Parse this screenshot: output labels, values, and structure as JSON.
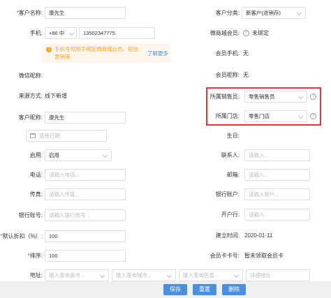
{
  "left": {
    "customer_name_label": "客户名称:",
    "customer_name_value": "康先生",
    "phone_label": "手机:",
    "phone_code": "+86 中",
    "phone_value": "13502347775",
    "warning_text_1": "手机号可用于绑定微商城会员、短信",
    "warning_text_2": "营销等",
    "warning_link": "了解更多",
    "wechat_nick_label": "微信昵称:",
    "source_label": "来源方式:",
    "source_value": "线下新增",
    "nickname_label": "客户昵称:",
    "nickname_value": "康先生",
    "birthday_placeholder": "选择日期",
    "enable_label": "启用:",
    "enable_value": "启用",
    "phone2_label": "电话:",
    "phone2_placeholder": "请输入电话...",
    "fax_label": "传真:",
    "fax_placeholder": "请输入传真...",
    "bank_account_no_label": "银行账号:",
    "bank_account_no_placeholder": "请输入银行账号...",
    "discount_label": "默认折扣（%）:",
    "discount_value": "100",
    "sort_label": "排序:",
    "sort_value": "100",
    "address_label": "地址:",
    "province_placeholder": "输入查询省市...",
    "city_placeholder": "输入查询城市...",
    "district_placeholder": "输入查询区县...",
    "detail_placeholder": "详细地址"
  },
  "right": {
    "category_label": "客户分类:",
    "category_value": "新客户(进销存)",
    "mall_member_label": "微商城会员:",
    "mall_member_value": "未绑定",
    "member_phone_label": "会员手机:",
    "member_phone_value": "无",
    "member_nick_label": "会员昵称:",
    "member_nick_value": "无",
    "sales_label": "所属销售员:",
    "sales_value": "零售销售员",
    "store_label": "所属门店:",
    "store_value": "零售门店",
    "birthday_label": "生日:",
    "contact_label": "联系人:",
    "contact_placeholder": "请输入...",
    "email_label": "邮箱:",
    "email_placeholder": "请输入...",
    "bank_label": "银行账户:",
    "bank_placeholder": "请输入账户...",
    "bank_branch_label": "开户行:",
    "bank_branch_placeholder": "请输入...",
    "created_label": "建立时间:",
    "created_value": "2020-01-11",
    "card_label": "会员卡卡号:",
    "card_value": "暂未领取会员卡"
  },
  "buttons": {
    "save": "保存",
    "reset": "重置",
    "delete": "删除"
  },
  "colors": {
    "primary": "#4a90e2",
    "warning_bg": "#fdf6ec",
    "warning_icon": "#f5a623",
    "highlight_border": "#e4393c",
    "required": "#e4393c"
  }
}
